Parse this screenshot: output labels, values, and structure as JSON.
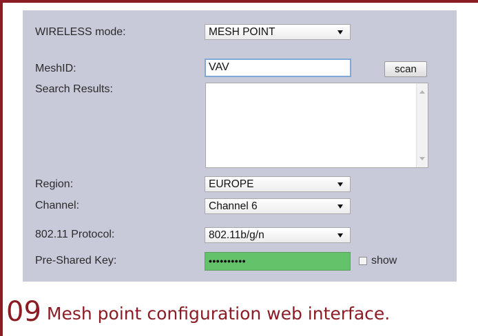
{
  "form": {
    "wireless_mode": {
      "label": "WIRELESS mode:",
      "value": "MESH POINT"
    },
    "mesh_id": {
      "label": "MeshID:",
      "value": "VAV"
    },
    "scan_button": "scan",
    "search_results": {
      "label": "Search Results:",
      "items": []
    },
    "region": {
      "label": "Region:",
      "value": "EUROPE"
    },
    "channel": {
      "label": "Channel:",
      "value": "Channel 6"
    },
    "protocol": {
      "label": "802.11 Protocol:",
      "value": "802.11b/g/n"
    },
    "psk": {
      "label": "Pre-Shared Key:",
      "masked_value": "••••••••••",
      "show_label": "show",
      "show_checked": false
    }
  },
  "caption": {
    "number": "09",
    "text": "Mesh point configuration web interface."
  },
  "colors": {
    "frame": "#8b1c24",
    "panel": "#c8c9d9",
    "key_field": "#63c26a"
  }
}
